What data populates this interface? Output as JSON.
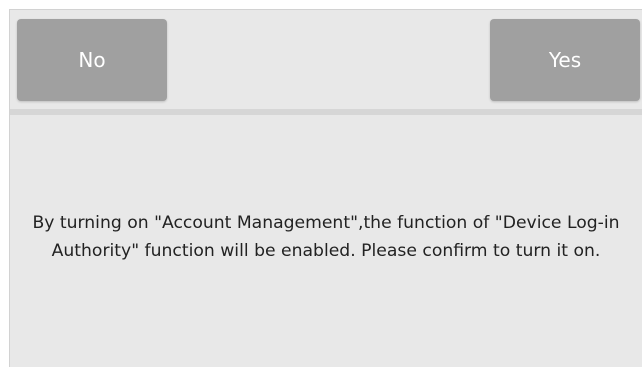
{
  "dialog": {
    "buttons": {
      "no_label": "No",
      "yes_label": "Yes"
    },
    "message": "By turning on \"Account Management\",the function of \"Device Log-in Authority\" function will be enabled. Please confirm to turn it on."
  }
}
